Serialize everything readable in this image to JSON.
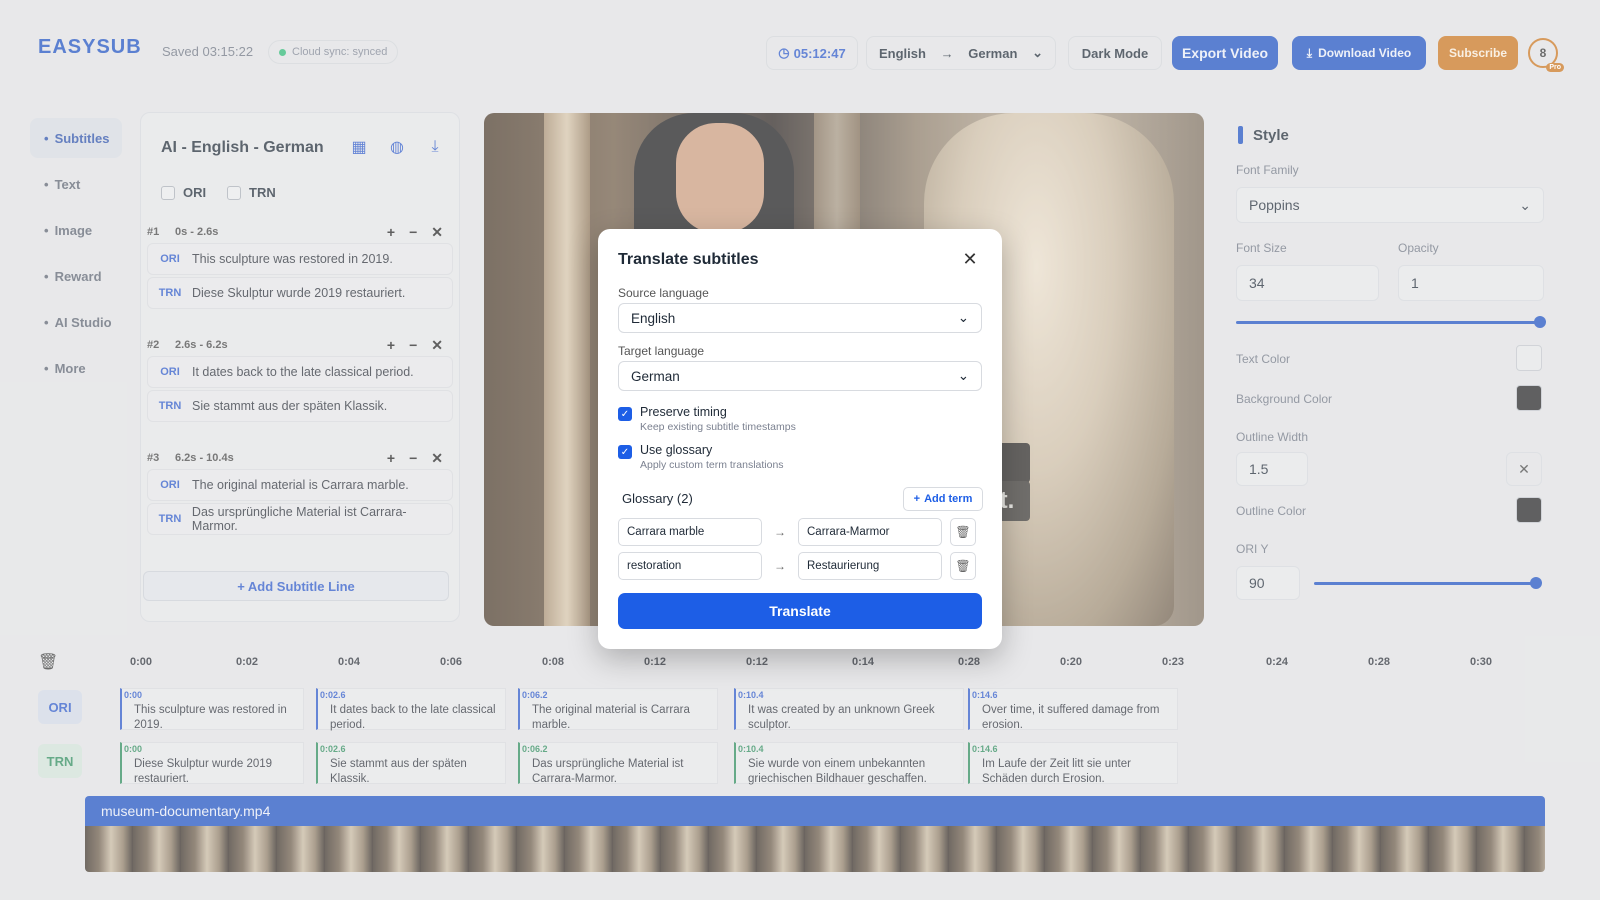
{
  "header": {
    "logo_text": "EASYSUB",
    "saved": "Saved 03:15:22",
    "sync": "Cloud sync: synced",
    "timer": "05:12:47",
    "lang_from": "English",
    "lang_to": "German",
    "dark_mode": "Dark Mode",
    "export": "Export Video",
    "download": "Download Video",
    "subscribe": "Subscribe",
    "avatar": "8",
    "badge": "Pro"
  },
  "nav": [
    "Subtitles",
    "Text",
    "Image",
    "Reward",
    "AI Studio",
    "More"
  ],
  "panel": {
    "title": "AI - English - German",
    "ori_label": "ORI",
    "trn_label": "TRN",
    "segments": [
      {
        "num": "#1",
        "time": "0s - 2.6s",
        "ori": "This sculpture was restored in 2019.",
        "trn": "Diese Skulptur wurde 2019 restauriert."
      },
      {
        "num": "#2",
        "time": "2.6s - 6.2s",
        "ori": "It dates back to the late classical period.",
        "trn": "Sie stammt aus der späten Klassik."
      },
      {
        "num": "#3",
        "time": "6.2s - 10.4s",
        "ori": "The original material is Carrara marble.",
        "trn": "Das ursprüngliche Material ist Carrara-Marmor."
      }
    ],
    "add_line": "+ Add Subtitle Line"
  },
  "video": {
    "overlay_text": "t."
  },
  "style": {
    "title": "Style",
    "font_family_label": "Font Family",
    "font_family": "Poppins",
    "font_size_label": "Font Size",
    "font_size": "34",
    "opacity_label": "Opacity",
    "opacity": "1",
    "text_color_label": "Text Color",
    "bg_color_label": "Background Color",
    "outline_width_label": "Outline Width",
    "outline_width": "1.5",
    "outline_color_label": "Outline Color",
    "ori_y_label": "ORI Y",
    "ori_y": "90",
    "colors": {
      "text": "#e4e5e7",
      "background": "#232325",
      "outline": "#232325"
    }
  },
  "timeline": {
    "ticks": [
      "0:00",
      "0:02",
      "0:04",
      "0:06",
      "0:08",
      "0:12",
      "0:12",
      "0:14",
      "0:28",
      "0:20",
      "0:23",
      "0:24",
      "0:28",
      "0:30"
    ],
    "ori_label": "ORI",
    "trn_label": "TRN",
    "ori_clips": [
      {
        "ts": "0:00",
        "text": "This sculpture was restored in 2019."
      },
      {
        "ts": "0:02.6",
        "text": "It dates back to the late classical period."
      },
      {
        "ts": "0:06.2",
        "text": "The original material is Carrara marble."
      },
      {
        "ts": "0:10.4",
        "text": "It was created by an unknown Greek sculptor."
      },
      {
        "ts": "0:14.6",
        "text": "Over time, it suffered damage from erosion."
      }
    ],
    "trn_clips": [
      {
        "ts": "0:00",
        "text": "Diese Skulptur wurde 2019 restauriert."
      },
      {
        "ts": "0:02.6",
        "text": "Sie stammt aus der späten Klassik."
      },
      {
        "ts": "0:06.2",
        "text": "Das ursprüngliche Material ist Carrara-Marmor."
      },
      {
        "ts": "0:10.4",
        "text": "Sie wurde von einem unbekannten griechischen Bildhauer geschaffen."
      },
      {
        "ts": "0:14.6",
        "text": "Im Laufe der Zeit litt sie unter Schäden durch Erosion."
      }
    ],
    "file": "museum-documentary.mp4"
  },
  "modal": {
    "title": "Translate subtitles",
    "source_label": "Source language",
    "source": "English",
    "target_label": "Target language",
    "target": "German",
    "preserve": "Preserve timing",
    "preserve_sub": "Keep existing subtitle timestamps",
    "glossary_opt": "Use glossary",
    "glossary_sub": "Apply custom term translations",
    "glossary_title": "Glossary (2)",
    "add_term": "Add term",
    "terms": [
      {
        "from": "Carrara marble",
        "to": "Carrara-Marmor"
      },
      {
        "from": "restoration",
        "to": "Restaurierung"
      }
    ],
    "translate": "Translate"
  }
}
